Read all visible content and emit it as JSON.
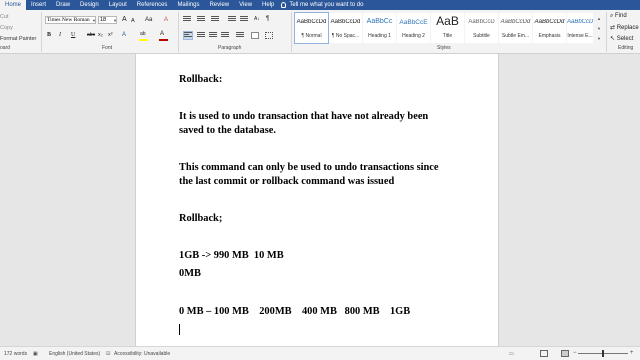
{
  "tabs": [
    "Home",
    "Insert",
    "Draw",
    "Design",
    "Layout",
    "References",
    "Mailings",
    "Review",
    "View",
    "Help"
  ],
  "tell_me": "Tell me what you want to do",
  "clipboard": {
    "cut": "Cut",
    "copy": "Copy",
    "format_painter": "Format Painter",
    "label": "oard"
  },
  "font": {
    "name": "Times New Roman",
    "size": "18",
    "label": "Font",
    "bold": "B",
    "italic": "I",
    "underline": "U",
    "strike": "abc",
    "sub": "x₂",
    "sup": "x²",
    "grow": "A",
    "shrink": "A",
    "case": "Aa",
    "clear": "A",
    "effects": "A",
    "highlight": "ab",
    "color": "A",
    "highlight_color": "#ffff00",
    "font_color": "#c00000"
  },
  "paragraph": {
    "label": "Paragraph"
  },
  "styles": {
    "label": "Styles",
    "items": [
      {
        "preview": "AaBbCcDd",
        "name": "¶ Normal"
      },
      {
        "preview": "AaBbCcDd",
        "name": "¶ No Spac..."
      },
      {
        "preview": "AaBbCc",
        "name": "Heading 1"
      },
      {
        "preview": "AaBbCcE",
        "name": "Heading 2"
      },
      {
        "preview": "AaB",
        "name": "Title"
      },
      {
        "preview": "AaBbCcD",
        "name": "Subtitle"
      },
      {
        "preview": "AaBbCcDd",
        "name": "Subtle Em..."
      },
      {
        "preview": "AaBbCcDd",
        "name": "Emphasis"
      },
      {
        "preview": "AaBbCcDd",
        "name": "Intense E..."
      }
    ]
  },
  "editing": {
    "find": "Find",
    "replace": "Replace",
    "select": "Select",
    "label": "Editing"
  },
  "document": {
    "lines": [
      "Rollback:",
      "It is used to undo transaction that have not already been",
      "saved to the database.",
      "This command can only be used to undo transactions since",
      "the last commit or rollback command was issued",
      "Rollback;",
      "1GB -> 990 MB  10 MB",
      "0MB",
      "0 MB – 100 MB    200MB    400 MB   800 MB    1GB"
    ]
  },
  "status": {
    "words": "172 words",
    "language": "English (United States)",
    "accessibility": "Accessibility: Unavailable"
  }
}
